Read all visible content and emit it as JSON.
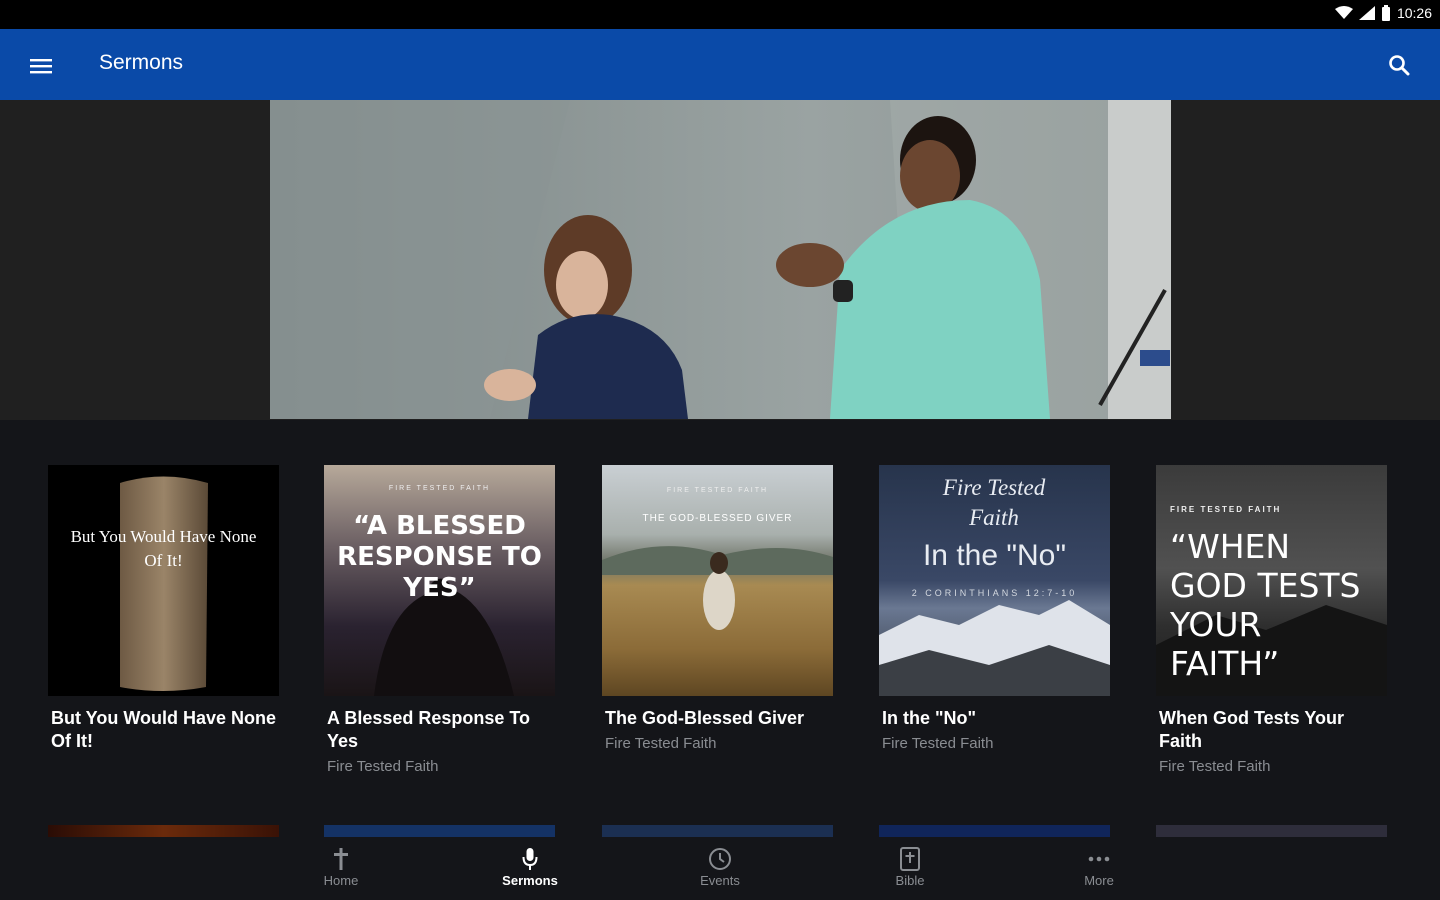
{
  "status": {
    "time": "10:26"
  },
  "app_bar": {
    "title": "Sermons"
  },
  "sermons": [
    {
      "title": "But You Would Have None Of It!",
      "subtitle": "",
      "art_text": "But You Would Have None Of It!"
    },
    {
      "title": "A Blessed Response To Yes",
      "subtitle": "Fire Tested Faith",
      "art_kicker": "FIRE TESTED FAITH",
      "art_text": "“A BLESSED RESPONSE TO YES”"
    },
    {
      "title": "The God-Blessed Giver",
      "subtitle": "Fire Tested Faith",
      "art_kicker": "FIRE TESTED FAITH",
      "art_text": "THE GOD-BLESSED GIVER"
    },
    {
      "title": "In the \"No\"",
      "subtitle": "Fire Tested Faith",
      "art_kicker": "Fire Tested Faith",
      "art_text": "In the \"No\"",
      "art_ref": "2 CORINTHIANS 12:7-10"
    },
    {
      "title": "When God Tests Your Faith",
      "subtitle": "Fire Tested Faith",
      "art_kicker": "FIRE TESTED FAITH",
      "art_text": "“WHEN GOD TESTS YOUR FAITH”"
    }
  ],
  "bottom_nav": [
    {
      "label": "Home",
      "icon": "cross-icon"
    },
    {
      "label": "Sermons",
      "icon": "microphone-icon",
      "active": true
    },
    {
      "label": "Events",
      "icon": "clock-icon"
    },
    {
      "label": "Bible",
      "icon": "bible-icon"
    },
    {
      "label": "More",
      "icon": "more-dots-icon"
    }
  ],
  "colors": {
    "app_bar": "#0a4aa8",
    "background": "#141519",
    "hero_band": "#202020"
  }
}
